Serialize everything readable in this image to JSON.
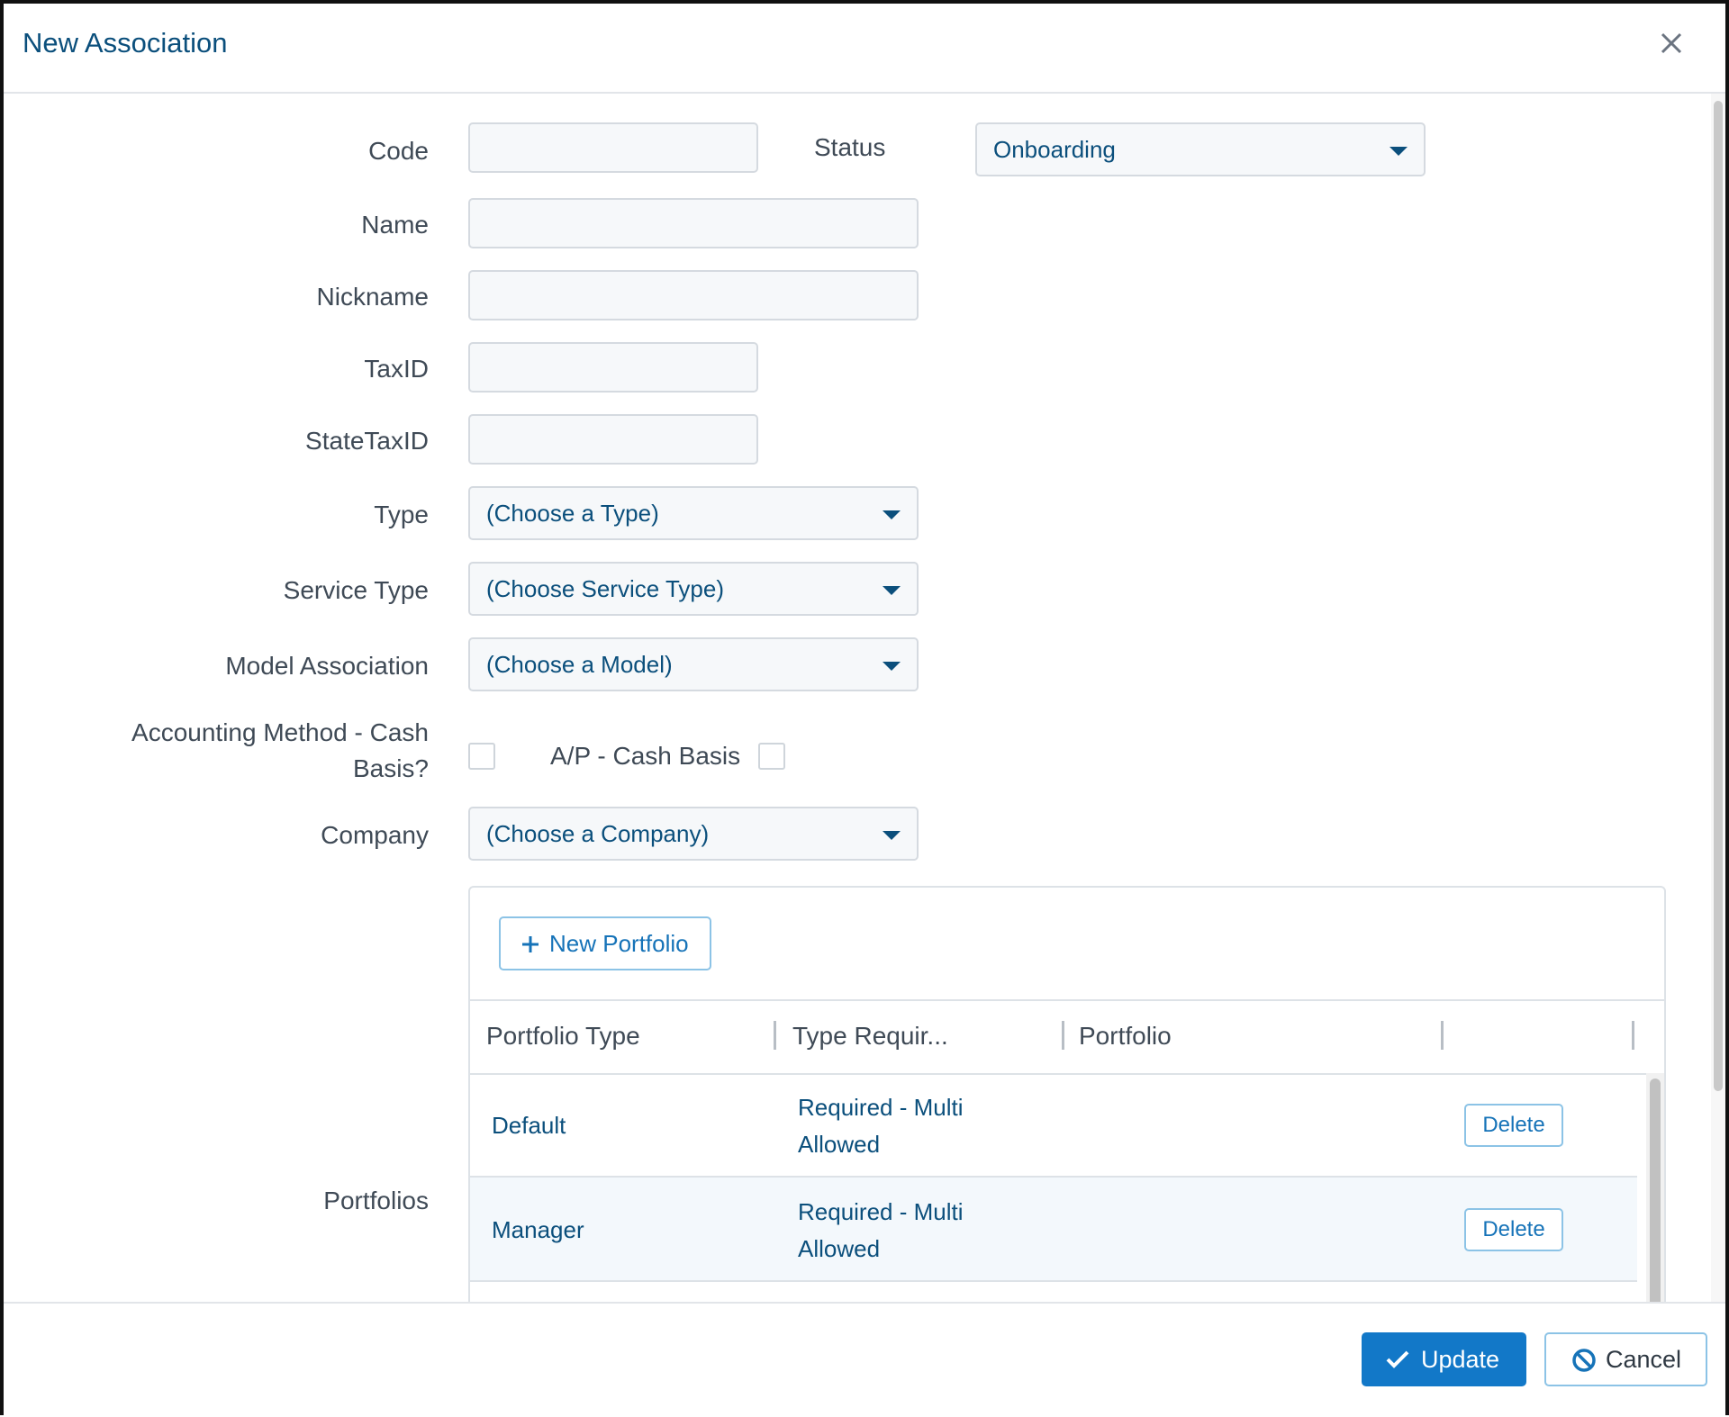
{
  "dialog": {
    "title": "New Association"
  },
  "form": {
    "code": {
      "label": "Code",
      "value": ""
    },
    "status": {
      "label": "Status",
      "value": "Onboarding"
    },
    "name": {
      "label": "Name",
      "value": ""
    },
    "nickname": {
      "label": "Nickname",
      "value": ""
    },
    "taxid": {
      "label": "TaxID",
      "value": ""
    },
    "statetaxid": {
      "label": "StateTaxID",
      "value": ""
    },
    "type": {
      "label": "Type",
      "value": "(Choose a Type)"
    },
    "service_type": {
      "label": "Service Type",
      "value": "(Choose Service Type)"
    },
    "model_association": {
      "label": "Model Association",
      "value": "(Choose a Model)"
    },
    "accounting_method": {
      "label_line1": "Accounting Method - Cash",
      "label_line2": "Basis?",
      "checked": false
    },
    "ap_cash_basis": {
      "label": "A/P - Cash Basis",
      "checked": false
    },
    "company": {
      "label": "Company",
      "value": "(Choose a Company)"
    },
    "portfolios_label": "Portfolios"
  },
  "portfolios": {
    "new_button": "New Portfolio",
    "columns": [
      "Portfolio Type",
      "Type Requir...",
      "Portfolio",
      ""
    ],
    "rows": [
      {
        "type": "Default",
        "requirement_line1": "Required - Multi",
        "requirement_line2": "Allowed",
        "portfolio": "",
        "delete": "Delete"
      },
      {
        "type": "Manager",
        "requirement_line1": "Required - Multi",
        "requirement_line2": "Allowed",
        "portfolio": "",
        "delete": "Delete"
      }
    ]
  },
  "footer": {
    "update": "Update",
    "cancel": "Cancel"
  },
  "colors": {
    "accent": "#1278c8",
    "title": "#0b4f7c",
    "row_highlight": "#f3f8fc"
  }
}
